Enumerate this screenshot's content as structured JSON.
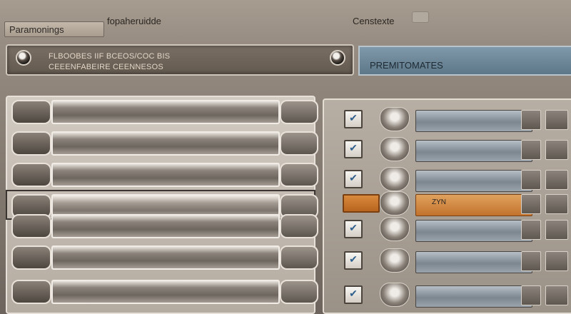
{
  "header": {
    "left_chip": "Paramonings",
    "title": "fopaheruidde",
    "right_label": "Censtexte"
  },
  "info_panel": {
    "line1": "FLBOOBES IIF BCEOS/COC BIS",
    "line2": "CEEENFABEIRE CEENNESOS",
    "tab_label": "PREMITOMATES"
  },
  "left_table": {
    "rows": [
      {
        "selected": false
      },
      {
        "selected": false
      },
      {
        "selected": false
      },
      {
        "selected": true
      },
      {
        "selected": false
      },
      {
        "selected": false
      },
      {
        "selected": false
      }
    ]
  },
  "right_list": {
    "rows": [
      {
        "checked": true,
        "field_text": "",
        "highlighted": false
      },
      {
        "checked": true,
        "field_text": "",
        "highlighted": false
      },
      {
        "checked": true,
        "field_text": "",
        "highlighted": false
      },
      {
        "checked": false,
        "field_text": "ZYN",
        "highlighted": true
      },
      {
        "checked": true,
        "field_text": "",
        "highlighted": false
      },
      {
        "checked": true,
        "field_text": "",
        "highlighted": false
      },
      {
        "checked": true,
        "field_text": "",
        "highlighted": false
      }
    ]
  },
  "colors": {
    "accent_blue": "#5d7889",
    "accent_orange": "#c2722c",
    "panel_dark": "#62594f"
  }
}
